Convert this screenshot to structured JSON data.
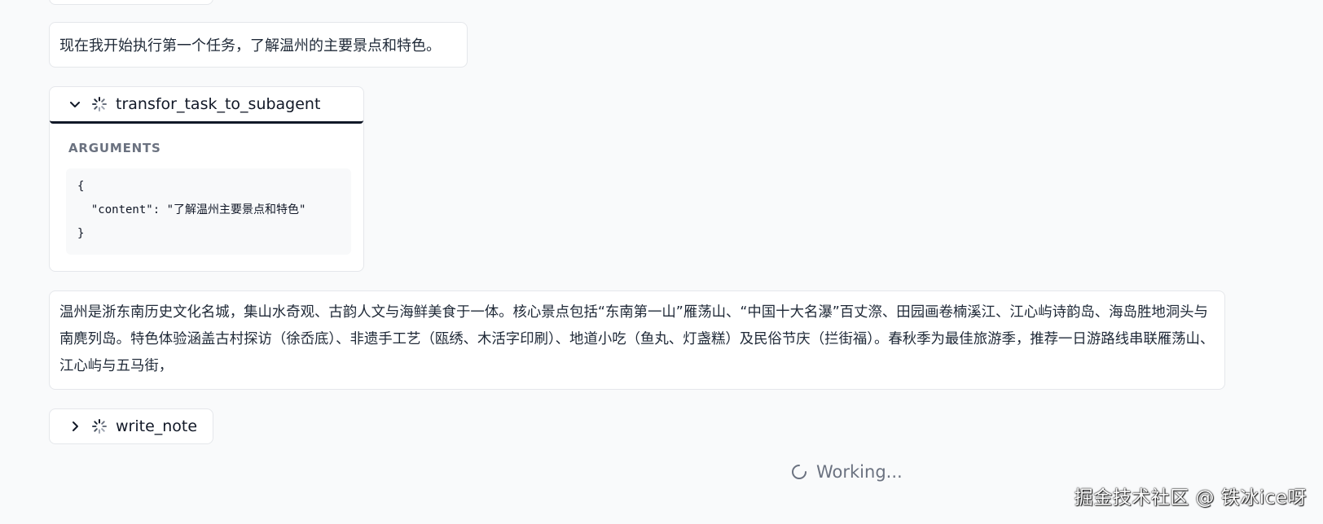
{
  "messages": {
    "msg1": "现在我开始执行第一个任务，了解温州的主要景点和特色。",
    "msg2": "温州是浙东南历史文化名城，集山水奇观、古韵人文与海鲜美食于一体。核心景点包括“东南第一山”雁荡山、“中国十大名瀑”百丈漈、田园画卷楠溪江、江心屿诗韵岛、海岛胜地洞头与南麂列岛。特色体验涵盖古村探访（徐岙底）、非遗手工艺（瓯绣、木活字印刷）、地道小吃（鱼丸、灯盏糕）及民俗节庆（拦街福）。春秋季为最佳旅游季，推荐一日游路线串联雁荡山、江心屿与五马街，"
  },
  "tool_call_1": {
    "name": "transfor_task_to_subagent",
    "state": "expanded",
    "arguments_label": "ARGUMENTS",
    "arguments_code": "{\n  \"content\": \"了解温州主要景点和特色\"\n}",
    "icons": [
      "chevron-down-icon",
      "loading-spinner-icon"
    ]
  },
  "tool_call_2": {
    "name": "write_note",
    "state": "collapsed",
    "icons": [
      "chevron-right-icon",
      "loading-spinner-icon"
    ]
  },
  "status": {
    "text": "Working...",
    "icon": "spinner-icon"
  },
  "watermark": "掘金技术社区 @ 铁冰ice呀",
  "colors": {
    "background": "#f9fafb",
    "card": "#ffffff",
    "border": "#e5e7eb",
    "muted_text": "#6b7280",
    "text": "#1f2937"
  }
}
